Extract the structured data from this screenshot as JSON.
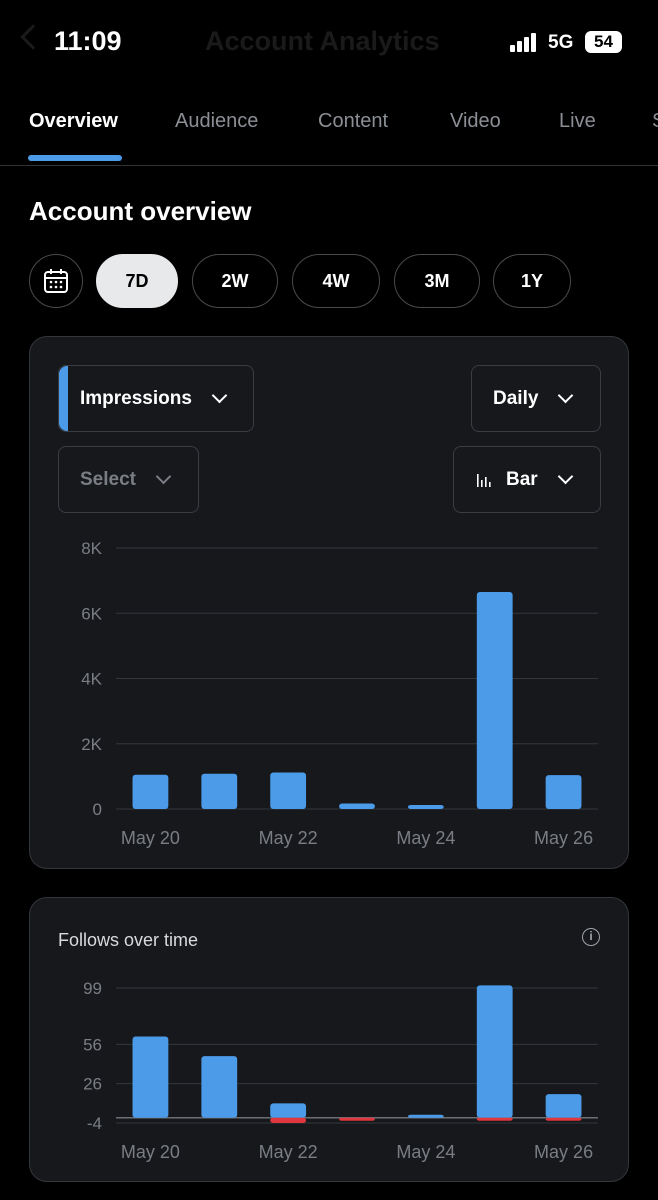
{
  "status_bar": {
    "time": "11:09",
    "network": "5G",
    "battery": "54",
    "background_title": "Account Analytics"
  },
  "tabs": [
    {
      "label": "Overview",
      "active": true
    },
    {
      "label": "Audience",
      "active": false
    },
    {
      "label": "Content",
      "active": false
    },
    {
      "label": "Video",
      "active": false
    },
    {
      "label": "Live",
      "active": false
    },
    {
      "label": "S",
      "active": false
    }
  ],
  "overview": {
    "title": "Account overview",
    "calendar_icon": "calendar-icon",
    "ranges": [
      {
        "label": "7D",
        "selected": true
      },
      {
        "label": "2W",
        "selected": false
      },
      {
        "label": "4W",
        "selected": false
      },
      {
        "label": "3M",
        "selected": false
      },
      {
        "label": "1Y",
        "selected": false
      }
    ]
  },
  "impressions_card": {
    "metric_select": "Impressions",
    "interval_select": "Daily",
    "compare_select": "Select",
    "chart_type_select": "Bar",
    "chart_type_icon": "bar-chart-icon"
  },
  "follows_card": {
    "title": "Follows over time",
    "info_icon": "info-icon"
  },
  "colors": {
    "accent": "#4c9be8",
    "negative": "#e0363d",
    "background": "#000000",
    "card": "#16181c"
  },
  "chart_data": [
    {
      "type": "bar",
      "title": "",
      "categories": [
        "May 20",
        "May 21",
        "May 22",
        "May 23",
        "May 24",
        "May 25",
        "May 26"
      ],
      "x_tick_labels": [
        "May 20",
        "May 22",
        "May 24",
        "May 26"
      ],
      "y_tick_labels": [
        "8K",
        "6K",
        "4K",
        "2K",
        "0"
      ],
      "y_ticks": [
        8000,
        6000,
        4000,
        2000,
        0
      ],
      "ylim": [
        0,
        8000
      ],
      "series": [
        {
          "values": [
            1050,
            1080,
            1120,
            170,
            110,
            6650,
            1040
          ],
          "color": "#4c9be8"
        }
      ],
      "grid": true
    },
    {
      "type": "bar",
      "title": "Follows over time",
      "categories": [
        "May 20",
        "May 21",
        "May 22",
        "May 23",
        "May 24",
        "May 25",
        "May 26"
      ],
      "x_tick_labels": [
        "May 20",
        "May 22",
        "May 24",
        "May 26"
      ],
      "y_tick_labels": [
        "99",
        "56",
        "26",
        "-4"
      ],
      "y_ticks": [
        99,
        56,
        26,
        -4
      ],
      "ylim": [
        -4,
        99
      ],
      "stacked": true,
      "series": [
        {
          "name": "gained",
          "values": [
            62,
            47,
            11,
            0,
            1,
            101,
            18
          ],
          "color": "#4c9be8"
        },
        {
          "name": "lost",
          "values": [
            0,
            0,
            -4,
            -2,
            0,
            -1,
            -1
          ],
          "color": "#e0363d"
        }
      ],
      "grid": true
    }
  ]
}
